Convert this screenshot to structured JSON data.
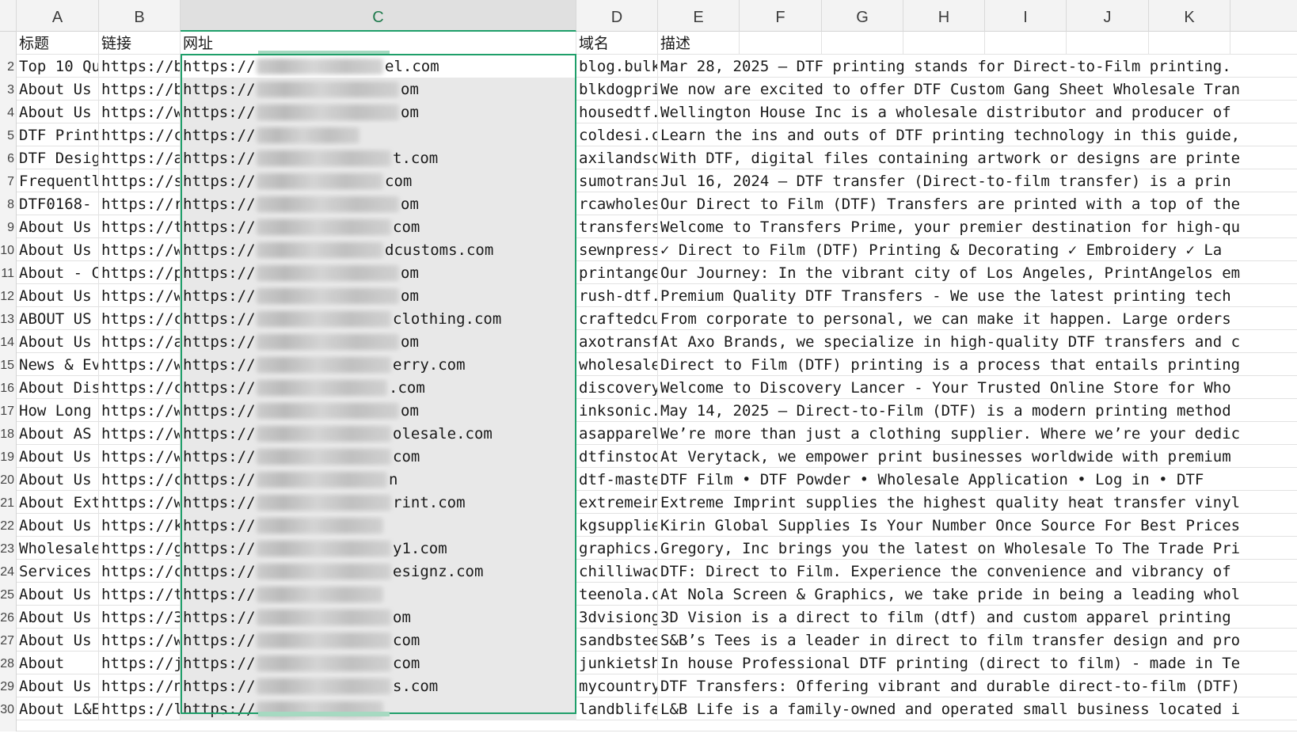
{
  "columns": [
    {
      "letter": "A"
    },
    {
      "letter": "B"
    },
    {
      "letter": "C",
      "selected": true
    },
    {
      "letter": "D"
    },
    {
      "letter": "E"
    },
    {
      "letter": "F"
    },
    {
      "letter": "G"
    },
    {
      "letter": "H"
    },
    {
      "letter": "I"
    },
    {
      "letter": "J"
    },
    {
      "letter": "K"
    }
  ],
  "header_row": {
    "a": "标题",
    "b": "链接",
    "c": "网址",
    "d": "域名",
    "e": "描述"
  },
  "rows": [
    {
      "n": "2",
      "a": "Top 10 Qu",
      "b": "https://b",
      "c_prefix": "https://",
      "c_suffix": "el.com",
      "d": "blog.bulk",
      "e": "Mar 28, 2025 — DTF printing stands for Direct-to-Film printing."
    },
    {
      "n": "3",
      "a": "About Us",
      "b": "https://b",
      "c_prefix": "https://",
      "c_suffix": "om",
      "d": "blkdogpri",
      "e": "We now are excited to offer DTF Custom Gang Sheet Wholesale Tran"
    },
    {
      "n": "4",
      "a": "About Us",
      "b": "https://w",
      "c_prefix": "https://",
      "c_suffix": "om",
      "d": "housedtf.",
      "e": "Wellington House Inc is a wholesale distributor and producer of"
    },
    {
      "n": "5",
      "a": "DTF Print",
      "b": "https://c",
      "c_prefix": "https://",
      "c_suffix": "",
      "d": "coldesi.c",
      "e": "Learn the ins and outs of DTF printing technology in this guide,"
    },
    {
      "n": "6",
      "a": "DTF Desig",
      "b": "https://a",
      "c_prefix": "https://",
      "c_suffix": "t.com",
      "d": "axilandsc",
      "e": "With DTF, digital files containing artwork or designs are printe"
    },
    {
      "n": "7",
      "a": "Frequentl",
      "b": "https://s",
      "c_prefix": "https://",
      "c_suffix": "com",
      "d": "sumotrans",
      "e": "Jul 16, 2024 — DTF transfer (Direct-to-film transfer) is a prin"
    },
    {
      "n": "8",
      "a": "DTF0168-",
      "b": "https://r",
      "c_prefix": "https://",
      "c_suffix": "om",
      "d": "rcawholes",
      "e": "Our Direct to Film (DTF) Transfers are printed with a top of the"
    },
    {
      "n": "9",
      "a": "About Us",
      "b": "https://t",
      "c_prefix": "https://",
      "c_suffix": "com",
      "d": "transfers",
      "e": "Welcome to Transfers Prime, your premier destination for high-qu"
    },
    {
      "n": "10",
      "a": "About Us",
      "b": "https://w",
      "c_prefix": "https://",
      "c_suffix": "dcustoms.com",
      "d": "sewnpress",
      "e": "✓ Direct to Film (DTF) Printing & Decorating ✓ Embroidery ✓ La"
    },
    {
      "n": "11",
      "a": "About - C",
      "b": "https://p",
      "c_prefix": "https://",
      "c_suffix": "om",
      "d": "printange",
      "e": "Our Journey: In the vibrant city of Los Angeles, PrintAngelos em"
    },
    {
      "n": "12",
      "a": "About Us",
      "b": "https://w",
      "c_prefix": "https://",
      "c_suffix": "om",
      "d": "rush-dtf.",
      "e": "Premium Quality DTF Transfers - We use the latest printing tech"
    },
    {
      "n": "13",
      "a": "ABOUT US",
      "b": "https://c",
      "c_prefix": "https://",
      "c_suffix": "clothing.com",
      "d": "craftedcu",
      "e": "From corporate to personal, we can make it happen. Large orders"
    },
    {
      "n": "14",
      "a": "About Us",
      "b": "https://a",
      "c_prefix": "https://",
      "c_suffix": "om",
      "d": "axotransf",
      "e": "At Axo Brands, we specialize in high-quality DTF transfers and c"
    },
    {
      "n": "15",
      "a": "News & Ev",
      "b": "https://w",
      "c_prefix": "https://",
      "c_suffix": "erry.com",
      "d": "wholesale",
      "e": "Direct to Film (DTF) printing is a process that entails printing"
    },
    {
      "n": "16",
      "a": "About Dis",
      "b": "https://c",
      "c_prefix": "https://",
      "c_suffix": ".com",
      "d": "discovery",
      "e": "Welcome to Discovery Lancer - Your Trusted Online Store for Who"
    },
    {
      "n": "17",
      "a": "How Long",
      "b": "https://w",
      "c_prefix": "https://",
      "c_suffix": "om",
      "d": "inksonic.",
      "e": "May 14, 2025 — Direct-to-Film (DTF) is a modern printing method"
    },
    {
      "n": "18",
      "a": "About AS",
      "b": "https://w",
      "c_prefix": "https://",
      "c_suffix": "olesale.com",
      "d": "asapparel",
      "e": "We’re more than just a clothing supplier. Where we’re your dedic"
    },
    {
      "n": "19",
      "a": "About Us",
      "b": "https://w",
      "c_prefix": "https://",
      "c_suffix": "com",
      "d": "dtfinstoc",
      "e": "At Verytack, we empower print businesses worldwide with premium"
    },
    {
      "n": "20",
      "a": "About Us",
      "b": "https://c",
      "c_prefix": "https://",
      "c_suffix": "n",
      "d": "dtf-maste",
      "e": "DTF Film • DTF Powder • Wholesale Application • Log in • DTF"
    },
    {
      "n": "21",
      "a": "About Ext",
      "b": "https://w",
      "c_prefix": "https://",
      "c_suffix": "rint.com",
      "d": "extremein",
      "e": "Extreme Imprint supplies the highest quality heat transfer vinyl"
    },
    {
      "n": "22",
      "a": "About Us",
      "b": "https://k",
      "c_prefix": "https://",
      "c_suffix": "",
      "d": "kgsupplie",
      "e": "Kirin Global Supplies Is Your Number Once Source For Best Prices"
    },
    {
      "n": "23",
      "a": "Wholesale",
      "b": "https://g",
      "c_prefix": "https://",
      "c_suffix": "y1.com",
      "d": "graphics.",
      "e": "Gregory, Inc brings you the latest on Wholesale To The Trade Pri"
    },
    {
      "n": "24",
      "a": "Services",
      "b": "https://c",
      "c_prefix": "https://",
      "c_suffix": "esignz.com",
      "d": "chilliwac",
      "e": "DTF: Direct to Film. Experience the convenience and vibrancy of"
    },
    {
      "n": "25",
      "a": "About Us",
      "b": "https://t",
      "c_prefix": "https://",
      "c_suffix": "",
      "d": "teenola.c",
      "e": "At Nola Screen & Graphics, we take pride in being a leading whol"
    },
    {
      "n": "26",
      "a": "About Us",
      "b": "https://3",
      "c_prefix": "https://",
      "c_suffix": "om",
      "d": "3dvisiong",
      "e": "3D Vision is a direct to film (dtf) and custom apparel printing"
    },
    {
      "n": "27",
      "a": "About Us",
      "b": "https://w",
      "c_prefix": "https://",
      "c_suffix": "com",
      "d": "sandbstee",
      "e": "S&B’s Tees is a leader in direct to film transfer design and pro"
    },
    {
      "n": "28",
      "a": "About",
      "b": "https://j",
      "c_prefix": "https://",
      "c_suffix": "com",
      "d": "junkietsh",
      "e": "In house Professional DTF printing (direct to film) - made in Te"
    },
    {
      "n": "29",
      "a": "About Us",
      "b": "https://n",
      "c_prefix": "https://",
      "c_suffix": "s.com",
      "d": "mycountry",
      "e": "DTF Transfers: Offering vibrant and durable direct-to-film (DTF)"
    },
    {
      "n": "30",
      "a": "About L&E",
      "b": "https://l",
      "c_prefix": "https://",
      "c_suffix": "",
      "d": "landblife",
      "e": "L&B Life is a family-owned and operated small business located i"
    }
  ],
  "colors": {
    "selection": "#1f9f6a",
    "selected_column_fill": "#e8e8e8",
    "header_fill": "#f3f3f3"
  }
}
